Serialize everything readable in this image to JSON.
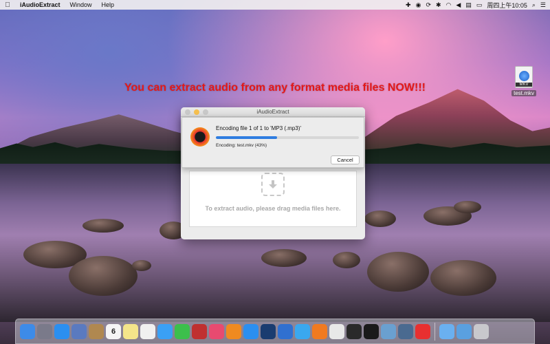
{
  "menubar": {
    "app_name": "iAudioExtract",
    "items": [
      "Window",
      "Help"
    ],
    "clock": "周四上午10:05"
  },
  "headline": "You can extract audio from any format media files NOW!!!",
  "desktop": {
    "file_name": "test.mkv",
    "file_ext": "MKV"
  },
  "window": {
    "title": "iAudioExtract",
    "drop_text": "To extract audio, please drag media files here."
  },
  "sheet": {
    "status": "Encoding file 1 of 1 to 'MP3 (.mp3)'",
    "detail": "Encoding: test.mkv (43%)",
    "progress": 0.43,
    "cancel_label": "Cancel"
  },
  "dock": {
    "icons": [
      {
        "name": "finder-icon",
        "color": "#3d8be8"
      },
      {
        "name": "launchpad-icon",
        "color": "#7a7a8a"
      },
      {
        "name": "safari-icon",
        "color": "#2b8ff0"
      },
      {
        "name": "photo-icon",
        "color": "#5a7ac0"
      },
      {
        "name": "contacts-icon",
        "color": "#b08850"
      },
      {
        "name": "calendar-icon",
        "color": "#f5f5f5"
      },
      {
        "name": "notes-icon",
        "color": "#f4e58a"
      },
      {
        "name": "reminders-icon",
        "color": "#f0f0f0"
      },
      {
        "name": "messages-icon",
        "color": "#3aa0f5"
      },
      {
        "name": "facetime-icon",
        "color": "#3cbf4c"
      },
      {
        "name": "photo-booth-icon",
        "color": "#c03030"
      },
      {
        "name": "itunes-icon",
        "color": "#e84a70"
      },
      {
        "name": "ibooks-icon",
        "color": "#f08a20"
      },
      {
        "name": "app-store-icon",
        "color": "#2b8ff0"
      },
      {
        "name": "quicktime-icon",
        "color": "#1a3c70"
      },
      {
        "name": "xcode-icon",
        "color": "#3070d0"
      },
      {
        "name": "twitter-icon",
        "color": "#3aa8ef"
      },
      {
        "name": "media-player-icon",
        "color": "#f07a20"
      },
      {
        "name": "document-icon",
        "color": "#e8e8e8"
      },
      {
        "name": "activity-monitor-icon",
        "color": "#2a2a2a"
      },
      {
        "name": "terminal-icon",
        "color": "#1a1a1a"
      },
      {
        "name": "preview-icon",
        "color": "#6aa0d0"
      },
      {
        "name": "image-capture-icon",
        "color": "#4a6a90"
      },
      {
        "name": "iaudioextract-icon",
        "color": "#e83030"
      },
      {
        "name": "folder-icon",
        "color": "#6ab0f0"
      },
      {
        "name": "downloads-icon",
        "color": "#5aa0e0"
      },
      {
        "name": "trash-icon",
        "color": "#c8c8cc"
      }
    ],
    "calendar_day": "6"
  }
}
